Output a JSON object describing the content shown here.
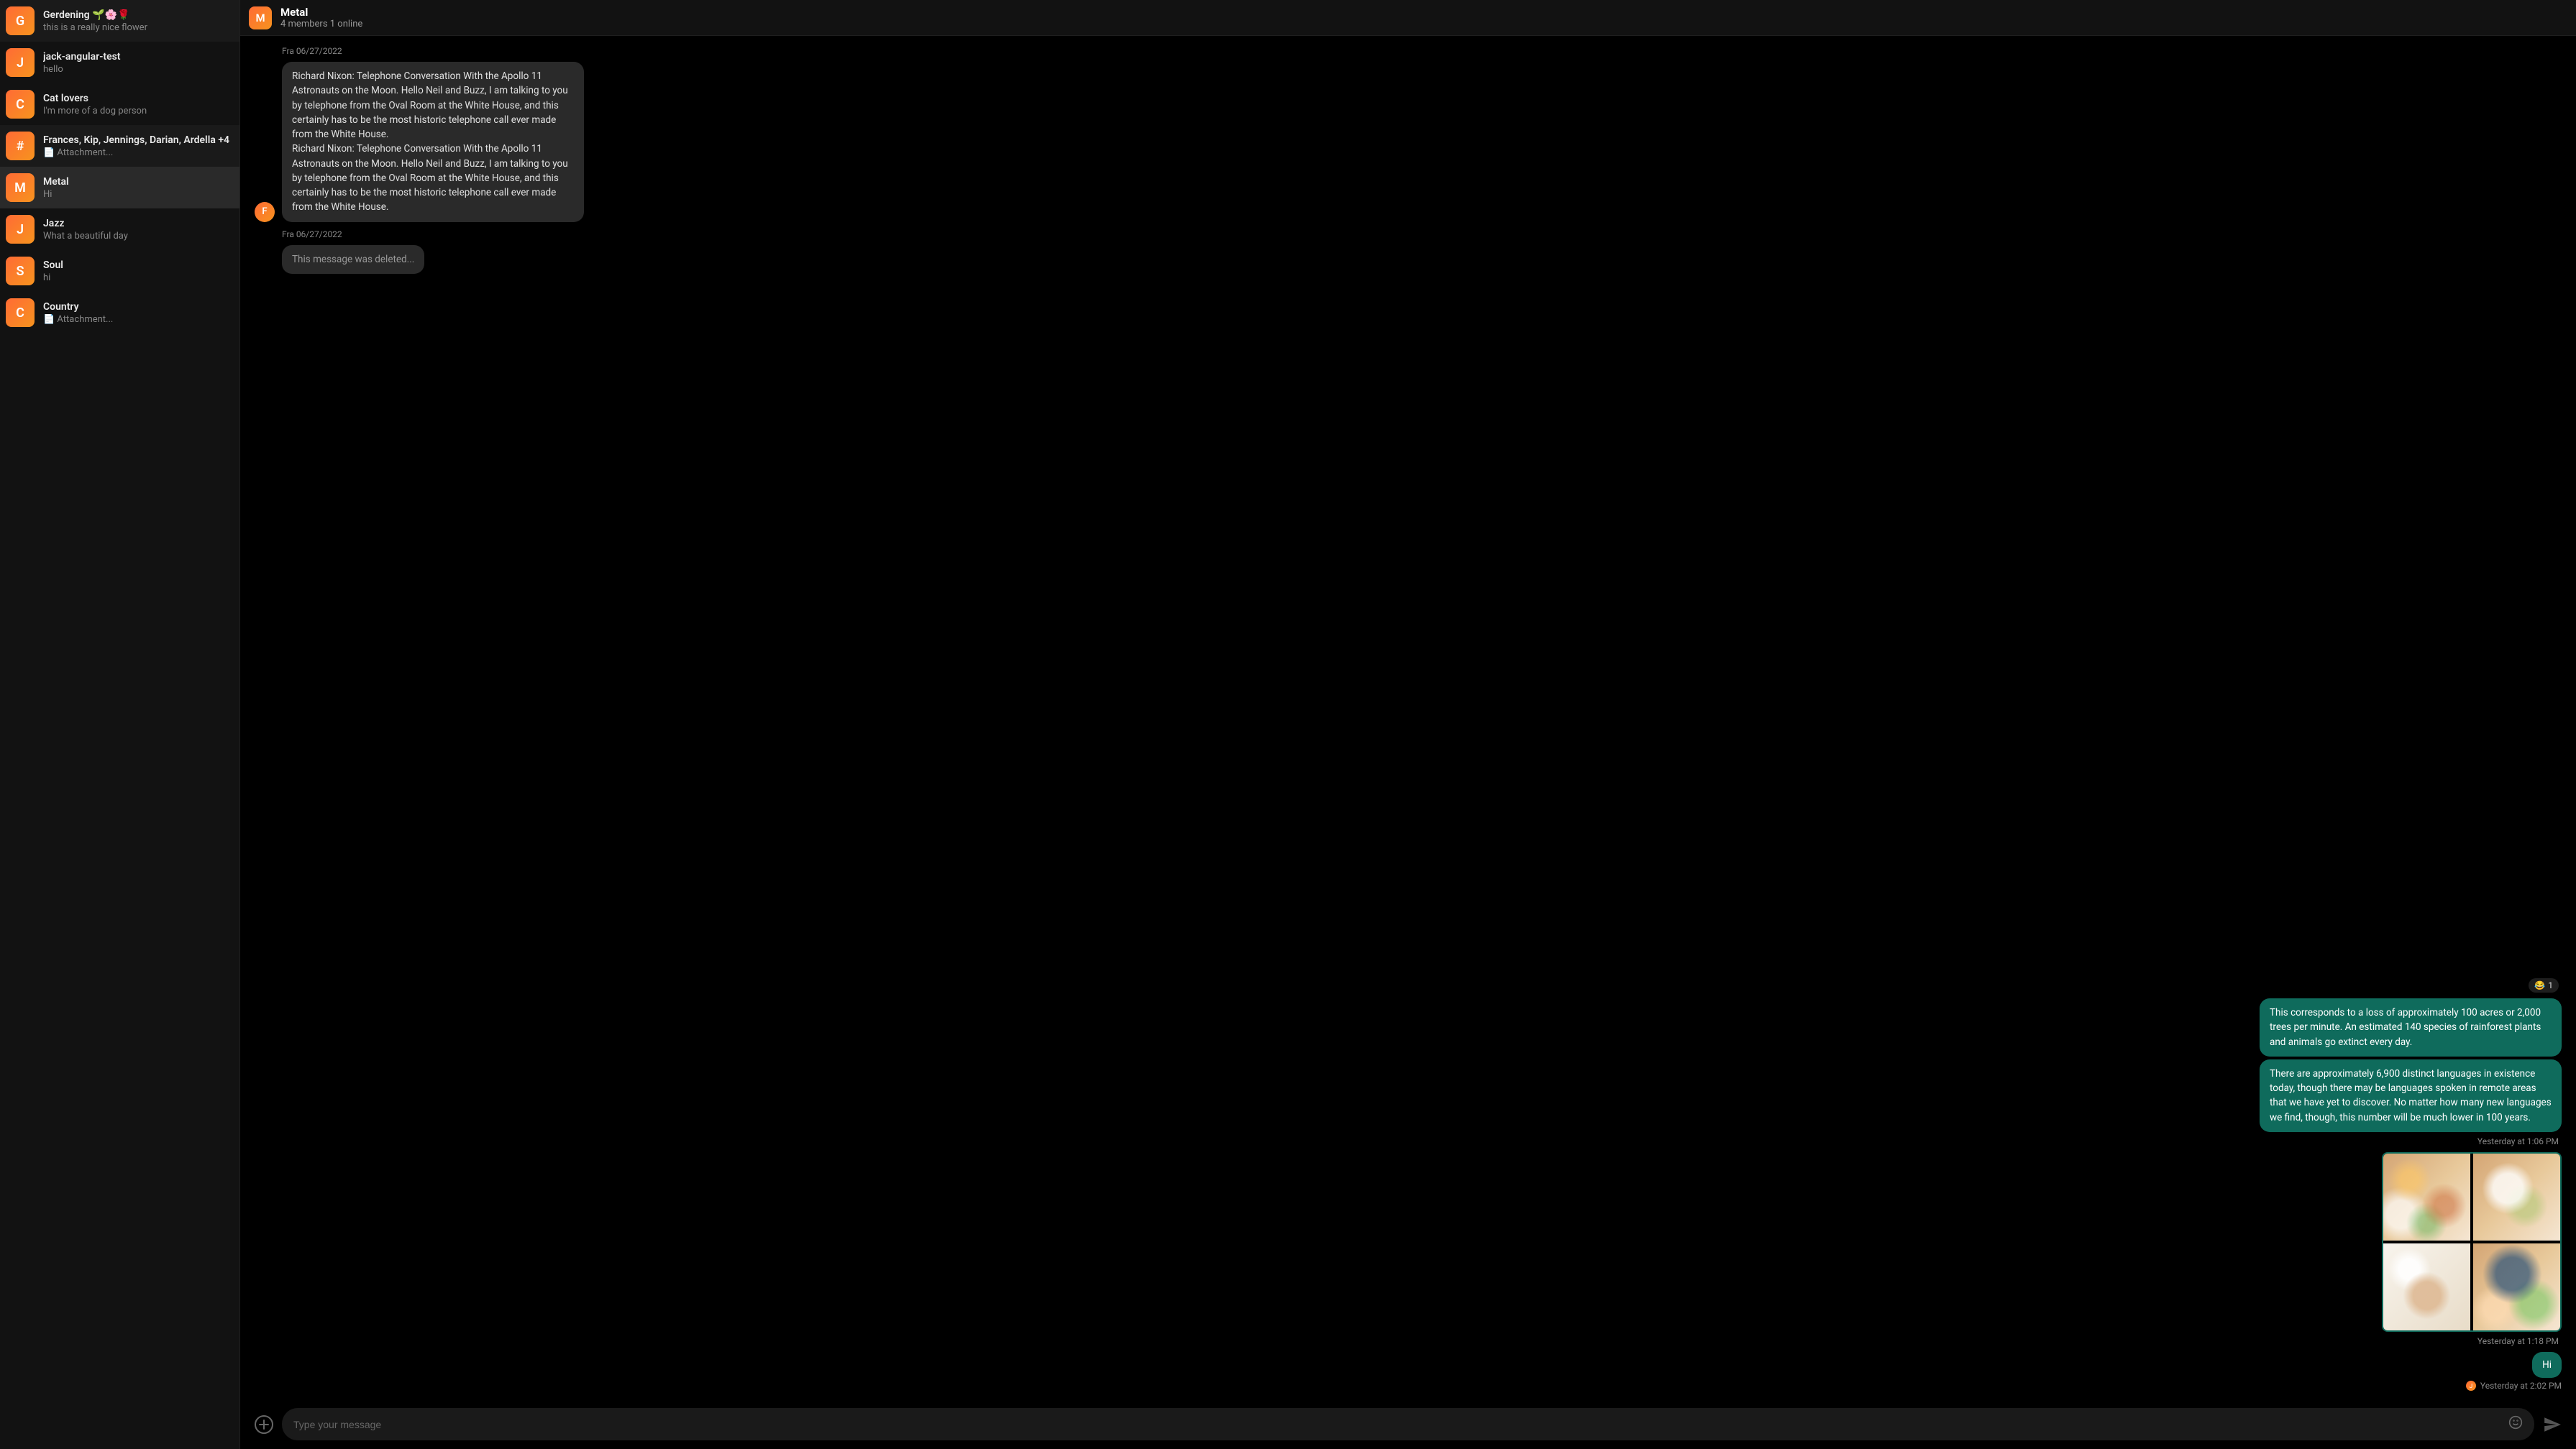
{
  "header": {
    "avatar_letter": "M",
    "title": "Metal",
    "subtitle": "4 members 1 online"
  },
  "sidebar": {
    "channels": [
      {
        "letter": "G",
        "name": "Gerdening 🌱🌸🌹",
        "preview": "this is a really nice flower",
        "active": false
      },
      {
        "letter": "J",
        "name": "jack-angular-test",
        "preview": "hello",
        "active": false
      },
      {
        "letter": "C",
        "name": "Cat lovers",
        "preview": "I'm more of a dog person",
        "active": false
      },
      {
        "letter": "#",
        "name": "Frances, Kip, Jennings, Darian, Ardella +4",
        "preview": "📄 Attachment...",
        "active": false,
        "highlighted": true
      },
      {
        "letter": "M",
        "name": "Metal",
        "preview": "Hi",
        "active": true
      },
      {
        "letter": "J",
        "name": "Jazz",
        "preview": "What a beautiful day",
        "active": false
      },
      {
        "letter": "S",
        "name": "Soul",
        "preview": "hi",
        "active": false
      },
      {
        "letter": "C",
        "name": "Country",
        "preview": "📄 Attachment...",
        "active": false
      }
    ]
  },
  "messages": {
    "top_meta": "Fra 06/27/2022",
    "nixon_text": "Richard Nixon: Telephone Conversation With the Apollo 11 Astronauts on the Moon. Hello Neil and Buzz, I am talking to you by telephone from the Oval Room at the White House, and this certainly has to be the most historic telephone call ever made from the White House.\nRichard Nixon: Telephone Conversation With the Apollo 11 Astronauts on the Moon. Hello Neil and Buzz, I am talking to you by telephone from the Oval Room at the White House, and this certainly has to be the most historic telephone call ever made from the White House.",
    "nixon_avatar": "F",
    "nixon_meta": "Fra 06/27/2022",
    "deleted_text": "This message was deleted...",
    "reaction_emoji": "😂",
    "reaction_count": "1",
    "own_msg_1": "This corresponds to a loss of approximately 100 acres or 2,000 trees per minute. An estimated 140 species of rainforest plants and animals go extinct every day.",
    "own_msg_2": "There are approximately 6,900 distinct languages in existence today, though there may be languages spoken in remote areas that we have yet to discover. No matter how many new languages we find, though, this number will be much lower in 100 years.",
    "own_meta_1": "Yesterday at 1:06 PM",
    "images_meta": "Yesterday at 1:18 PM",
    "hi_text": "Hi",
    "hi_meta": "Yesterday at 2:02 PM",
    "hi_read_letter": "J"
  },
  "composer": {
    "placeholder": "Type your message"
  }
}
